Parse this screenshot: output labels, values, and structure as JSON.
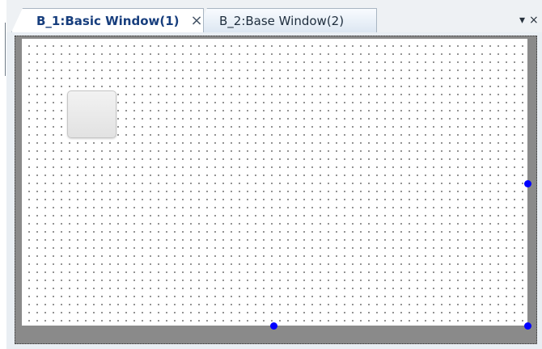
{
  "tabs": [
    {
      "label": "B_1:Basic Window(1)",
      "active": true,
      "close_icon": "close-icon"
    },
    {
      "label": "B_2:Base Window(2)",
      "active": false
    }
  ],
  "tab_tools": {
    "overflow_icon": "chevron-down-icon",
    "close_icon": "close-icon"
  },
  "canvas": {
    "grid": true,
    "background": "#ffffff",
    "border_color": "#8a8a8a",
    "handle_color": "#0000ff"
  }
}
